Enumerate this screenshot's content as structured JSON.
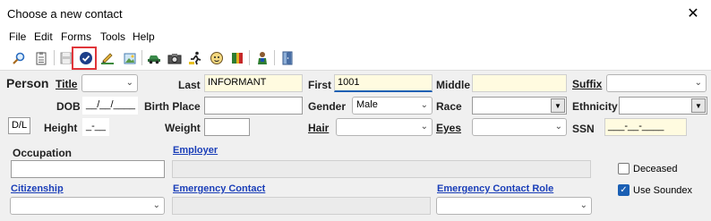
{
  "window": {
    "title": "Choose a new contact",
    "close_glyph": "✕"
  },
  "menu": [
    "File",
    "Edit",
    "Forms",
    "Tools",
    "Help"
  ],
  "toolbar_icons": [
    "search-icon",
    "clipboard-icon",
    "save-icon",
    "check-circle-icon",
    "pencil-icon",
    "image-icon",
    "car-icon",
    "camera-icon",
    "runner-icon",
    "face-icon",
    "book-icon",
    "person-icon",
    "door-icon"
  ],
  "form": {
    "person_label": "Person",
    "title_label": "Title",
    "last_label": "Last",
    "last_value": "INFORMANT",
    "first_label": "First",
    "first_value": "1001",
    "middle_label": "Middle",
    "suffix_label": "Suffix",
    "dob_label": "DOB",
    "dob_value": "__/__/____",
    "birthplace_label": "Birth Place",
    "gender_label": "Gender",
    "gender_value": "Male",
    "race_label": "Race",
    "ethnicity_label": "Ethnicity",
    "dl_button": "D/L",
    "height_label": "Height",
    "height_value": "_-__",
    "weight_label": "Weight",
    "hair_label": "Hair",
    "eyes_label": "Eyes",
    "ssn_label": "SSN",
    "ssn_value": "___-__-____",
    "occupation_label": "Occupation",
    "employer_label": "Employer",
    "deceased_label": "Deceased",
    "use_soundex_label": "Use Soundex",
    "citizenship_label": "Citizenship",
    "emergency_contact_label": "Emergency Contact",
    "emergency_contact_role_label": "Emergency Contact Role"
  },
  "colors": {
    "accent": "#1a3eb8",
    "highlight_box": "#e0353a",
    "required_field": "#fffbe0"
  },
  "state": {
    "deceased_checked": false,
    "use_soundex_checked": true
  }
}
